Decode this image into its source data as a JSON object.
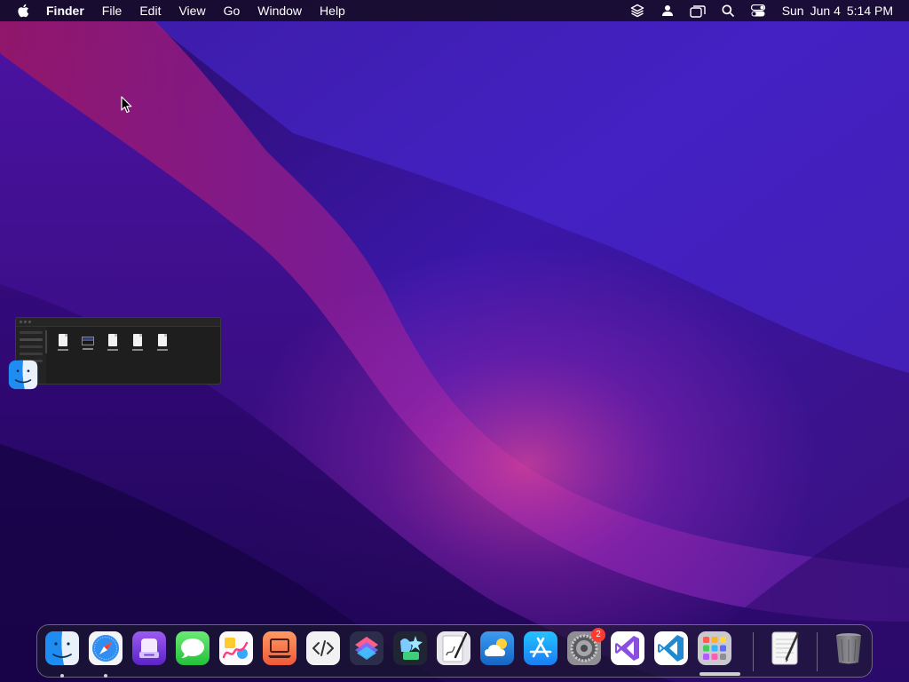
{
  "menubar": {
    "app_name": "Finder",
    "menus": [
      "File",
      "Edit",
      "View",
      "Go",
      "Window",
      "Help"
    ],
    "status_icons": [
      "layers-icon",
      "user-icon",
      "window-icon",
      "search-icon",
      "control-center-icon"
    ],
    "clock": {
      "day": "Sun",
      "date": "Jun 4",
      "time": "5:14 PM"
    }
  },
  "desktop": {
    "wallpaper": "macOS Monterey purple",
    "colors": {
      "dark": "#23084f",
      "magenta": "#c4156f",
      "violet": "#5b2bd0"
    }
  },
  "minimized_window": {
    "app": "Finder",
    "files": [
      {
        "kind": "document"
      },
      {
        "kind": "image"
      },
      {
        "kind": "document"
      },
      {
        "kind": "document"
      },
      {
        "kind": "document"
      }
    ]
  },
  "dock": {
    "apps": [
      {
        "name": "Finder",
        "icon": "finder-icon",
        "running": true
      },
      {
        "name": "Safari",
        "icon": "safari-icon",
        "running": true
      },
      {
        "name": "Podcast Manager",
        "icon": "archive-icon",
        "running": false
      },
      {
        "name": "Messages",
        "icon": "messages-icon",
        "running": false
      },
      {
        "name": "Freeform",
        "icon": "freeform-icon",
        "running": false
      },
      {
        "name": "Screens",
        "icon": "laptop-icon",
        "running": false
      },
      {
        "name": "Code Editor",
        "icon": "code-icon",
        "running": false
      },
      {
        "name": "Shortcuts",
        "icon": "shortcuts-icon",
        "running": false
      },
      {
        "name": "Design Tool",
        "icon": "design-icon",
        "running": false
      },
      {
        "name": "Script Editor",
        "icon": "script-icon",
        "running": false
      },
      {
        "name": "Weather",
        "icon": "weather-icon",
        "running": false
      },
      {
        "name": "App Store",
        "icon": "app-store-icon",
        "running": false
      },
      {
        "name": "System Settings",
        "icon": "settings-icon",
        "running": false,
        "badge": "2"
      },
      {
        "name": "Visual Studio",
        "icon": "visual-studio-icon",
        "running": false
      },
      {
        "name": "Visual Studio Code",
        "icon": "vscode-icon",
        "running": false
      },
      {
        "name": "Launchpad",
        "icon": "launchpad-icon",
        "running": false
      },
      {
        "name": "TextEdit",
        "icon": "textedit-icon",
        "running": false
      },
      {
        "name": "Trash",
        "icon": "trash-icon",
        "running": false
      }
    ]
  }
}
